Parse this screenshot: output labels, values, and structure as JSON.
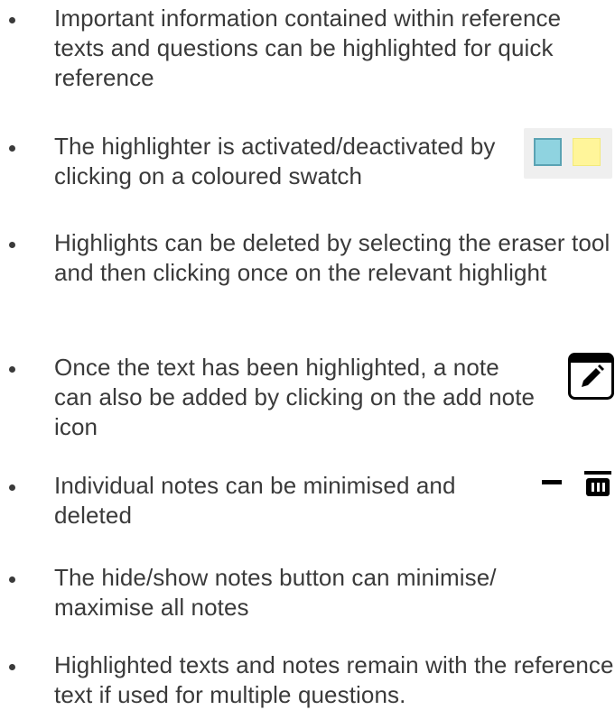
{
  "items": [
    {
      "text": "Important information contained within reference texts and questions can be highlighted for quick reference"
    },
    {
      "text": "The highlighter is activated/deactivated by clicking on a coloured swatch"
    },
    {
      "text": "Highlights can be deleted by selecting the eraser tool and then clicking once on the relevant highlight"
    },
    {
      "text": "Once the text has been highlighted, a note can also be added by clicking on the add note icon"
    },
    {
      "text": "Individual notes can be minimised and deleted"
    },
    {
      "text": "The hide/show notes button can minimise/ maximise all notes"
    },
    {
      "text": "Highlighted texts and notes remain with the reference text if used for multiple questions."
    }
  ],
  "swatches": {
    "colors": [
      "#8fd3e0",
      "#fff59a"
    ]
  },
  "icons": {
    "note": "add-note-icon",
    "minimise": "minimise-icon",
    "delete": "trash-icon"
  }
}
